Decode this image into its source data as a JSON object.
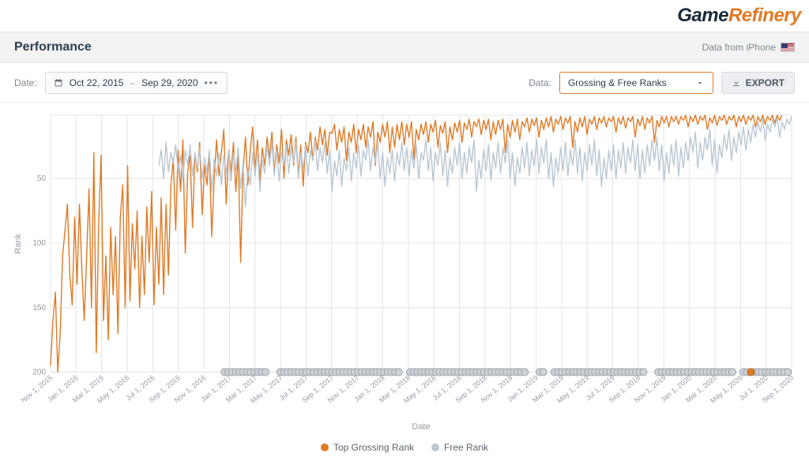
{
  "brand": {
    "name_a": "Game",
    "name_b": "Refinery"
  },
  "header": {
    "title": "Performance",
    "source_label": "Data from iPhone"
  },
  "controls": {
    "date_label": "Date:",
    "date_from": "Oct 22, 2015",
    "date_sep": "–",
    "date_to": "Sep 29, 2020",
    "data_label": "Data:",
    "data_select": "Grossing & Free Ranks",
    "export_label": "EXPORT"
  },
  "colors": {
    "grossing": "#e07a25",
    "free": "#b9c7d3",
    "grid": "#e2e4e8",
    "axis_text": "#949ba4",
    "dot_fill": "#cfd3d8",
    "dot_stroke": "#9aa0a6"
  },
  "chart_data": {
    "type": "line",
    "title": "Performance",
    "xlabel": "Date",
    "ylabel": "Rank",
    "y_ticks": [
      50,
      100,
      150,
      200
    ],
    "ylim": [
      200,
      1
    ],
    "x_ticks": [
      "Nov 1, 2015",
      "Jan 1, 2016",
      "Mar 1, 2016",
      "May 1, 2016",
      "Jul 1, 2016",
      "Sep 1, 2016",
      "Nov 1, 2016",
      "Jan 1, 2017",
      "Mar 1, 2017",
      "May 1, 2017",
      "Jul 1, 2017",
      "Sep 1, 2017",
      "Nov 1, 2017",
      "Jan 1, 2018",
      "Mar 1, 2018",
      "May 1, 2018",
      "Jul 1, 2018",
      "Sep 1, 2018",
      "Nov 1, 2018",
      "Jan 1, 2019",
      "Mar 1, 2019",
      "May 1, 2019",
      "Jul 1, 2019",
      "Sep 1, 2019",
      "Nov 1, 2019",
      "Jan 1, 2020",
      "Mar 1, 2020",
      "May 1, 2020",
      "Jul 1, 2020",
      "Sep 1, 2020"
    ],
    "series": [
      {
        "name": "Top Grossing Rank",
        "color": "#e07a25",
        "x_start": 0,
        "values": [
          195,
          160,
          138,
          200,
          170,
          110,
          90,
          70,
          125,
          148,
          80,
          132,
          70,
          120,
          160,
          110,
          58,
          150,
          30,
          185,
          85,
          32,
          160,
          110,
          175,
          88,
          140,
          95,
          170,
          80,
          55,
          150,
          40,
          145,
          85,
          120,
          75,
          150,
          95,
          140,
          72,
          115,
          60,
          148,
          88,
          132,
          65,
          140,
          70,
          125,
          55,
          35,
          90,
          28,
          60,
          20,
          108,
          45,
          32,
          88,
          30,
          45,
          22,
          78,
          40,
          55,
          30,
          95,
          50,
          20,
          48,
          30,
          12,
          70,
          28,
          45,
          22,
          60,
          30,
          115,
          45,
          18,
          55,
          28,
          10,
          44,
          20,
          52,
          26,
          40,
          18,
          34,
          14,
          45,
          24,
          38,
          12,
          50,
          20,
          32,
          16,
          40,
          18,
          48,
          24,
          56,
          22,
          30,
          14,
          36,
          18,
          28,
          10,
          24,
          12,
          32,
          14,
          15,
          8,
          28,
          12,
          22,
          10,
          36,
          14,
          22,
          8,
          30,
          12,
          20,
          8,
          26,
          10,
          18,
          6,
          40,
          14,
          22,
          8,
          18,
          6,
          30,
          10,
          26,
          8,
          20,
          6,
          24,
          8,
          18,
          6,
          35,
          12,
          20,
          8,
          16,
          6,
          22,
          8,
          14,
          5,
          26,
          9,
          15,
          6,
          30,
          10,
          20,
          7,
          14,
          5,
          22,
          7,
          12,
          4,
          18,
          6,
          10,
          4,
          16,
          5,
          12,
          4,
          20,
          6,
          16,
          5,
          12,
          4,
          30,
          8,
          18,
          5,
          14,
          4,
          20,
          6,
          10,
          3,
          14,
          4,
          9,
          3,
          18,
          5,
          12,
          3,
          10,
          2,
          14,
          4,
          8,
          2,
          12,
          3,
          7,
          2,
          26,
          6,
          14,
          3,
          10,
          2,
          16,
          4,
          8,
          2,
          12,
          3,
          7,
          2,
          10,
          3,
          6,
          2,
          14,
          3,
          8,
          2,
          11,
          3,
          6,
          2,
          18,
          4,
          9,
          2,
          12,
          3,
          7,
          2,
          22,
          5,
          10,
          2,
          7,
          2,
          10,
          2,
          6,
          2,
          8,
          2,
          5,
          1,
          10,
          2,
          6,
          1,
          8,
          2,
          5,
          1,
          12,
          3,
          7,
          1,
          9,
          2,
          5,
          1,
          8,
          2,
          5,
          1,
          10,
          2,
          6,
          1,
          8,
          2,
          5,
          1,
          10,
          2,
          6,
          1,
          8,
          2,
          5,
          1,
          7,
          1,
          5,
          1
        ]
      },
      {
        "name": "Free Rank",
        "color": "#b9c7d3",
        "x_start": 45,
        "values": [
          40,
          28,
          50,
          22,
          45,
          30,
          38,
          24,
          44,
          32,
          52,
          28,
          40,
          24,
          48,
          30,
          42,
          26,
          50,
          34,
          45,
          28,
          60,
          35,
          48,
          30,
          55,
          32,
          46,
          28,
          52,
          30,
          44,
          26,
          58,
          38,
          72,
          42,
          55,
          30,
          48,
          28,
          60,
          36,
          46,
          24,
          40,
          22,
          48,
          28,
          52,
          30,
          40,
          24,
          46,
          26,
          38,
          22,
          50,
          30,
          42,
          24,
          48,
          28,
          36,
          20,
          44,
          26,
          38,
          22,
          46,
          28,
          60,
          36,
          48,
          28,
          56,
          34,
          44,
          26,
          52,
          30,
          42,
          24,
          48,
          28,
          36,
          20,
          44,
          26,
          38,
          22,
          50,
          30,
          56,
          34,
          46,
          28,
          52,
          30,
          40,
          22,
          44,
          26,
          48,
          28,
          42,
          24,
          50,
          30,
          36,
          20,
          44,
          26,
          52,
          30,
          40,
          22,
          48,
          28,
          56,
          34,
          46,
          26,
          40,
          22,
          50,
          30,
          46,
          26,
          38,
          20,
          60,
          36,
          50,
          28,
          44,
          24,
          52,
          30,
          42,
          22,
          46,
          26,
          38,
          20,
          50,
          30,
          56,
          34,
          46,
          26,
          42,
          22,
          48,
          28,
          40,
          20,
          46,
          26,
          38,
          20,
          50,
          30,
          56,
          34,
          46,
          26,
          44,
          22,
          48,
          28,
          40,
          20,
          46,
          26,
          52,
          30,
          44,
          24,
          40,
          20,
          48,
          28,
          56,
          34,
          50,
          28,
          44,
          24,
          50,
          28,
          42,
          22,
          46,
          26,
          38,
          20,
          44,
          24,
          50,
          28,
          46,
          24,
          40,
          20,
          36,
          18,
          44,
          24,
          52,
          30,
          46,
          24,
          40,
          20,
          48,
          26,
          42,
          22,
          36,
          18,
          30,
          14,
          42,
          22,
          36,
          18,
          28,
          12,
          40,
          20,
          46,
          24,
          34,
          16,
          28,
          12,
          36,
          18,
          30,
          14,
          24,
          10,
          28,
          12,
          22,
          8,
          18,
          6,
          14,
          4,
          20,
          8,
          14,
          4,
          10,
          3,
          18,
          6,
          12,
          4,
          8,
          2
        ]
      }
    ],
    "bottom_markers": {
      "note": "Grey dots along x-axis indicate events (values clipped at rank 200). Approximate x positions as fractions of the axis width.",
      "x_positions": [
        0.235,
        0.24,
        0.245,
        0.25,
        0.255,
        0.26,
        0.265,
        0.27,
        0.275,
        0.28,
        0.285,
        0.29,
        0.31,
        0.315,
        0.32,
        0.325,
        0.33,
        0.335,
        0.34,
        0.345,
        0.35,
        0.355,
        0.36,
        0.365,
        0.37,
        0.375,
        0.38,
        0.385,
        0.39,
        0.395,
        0.4,
        0.405,
        0.41,
        0.415,
        0.42,
        0.425,
        0.43,
        0.435,
        0.44,
        0.445,
        0.45,
        0.455,
        0.46,
        0.465,
        0.47,
        0.485,
        0.49,
        0.495,
        0.5,
        0.505,
        0.51,
        0.515,
        0.52,
        0.525,
        0.53,
        0.535,
        0.54,
        0.545,
        0.55,
        0.555,
        0.56,
        0.565,
        0.57,
        0.575,
        0.58,
        0.585,
        0.59,
        0.595,
        0.6,
        0.605,
        0.61,
        0.615,
        0.62,
        0.625,
        0.63,
        0.635,
        0.64,
        0.66,
        0.665,
        0.68,
        0.685,
        0.69,
        0.695,
        0.7,
        0.705,
        0.71,
        0.715,
        0.72,
        0.725,
        0.73,
        0.735,
        0.74,
        0.745,
        0.75,
        0.755,
        0.76,
        0.765,
        0.77,
        0.775,
        0.78,
        0.785,
        0.79,
        0.795,
        0.8,
        0.82,
        0.825,
        0.83,
        0.835,
        0.84,
        0.845,
        0.85,
        0.855,
        0.86,
        0.865,
        0.87,
        0.875,
        0.88,
        0.885,
        0.89,
        0.895,
        0.9,
        0.905,
        0.91,
        0.915,
        0.92,
        0.935,
        0.94,
        0.945,
        0.95,
        0.955,
        0.96,
        0.965,
        0.97,
        0.975,
        0.98,
        0.985,
        0.99,
        0.995
      ]
    }
  },
  "legend": {
    "items": [
      "Top Grossing Rank",
      "Free Rank"
    ]
  }
}
